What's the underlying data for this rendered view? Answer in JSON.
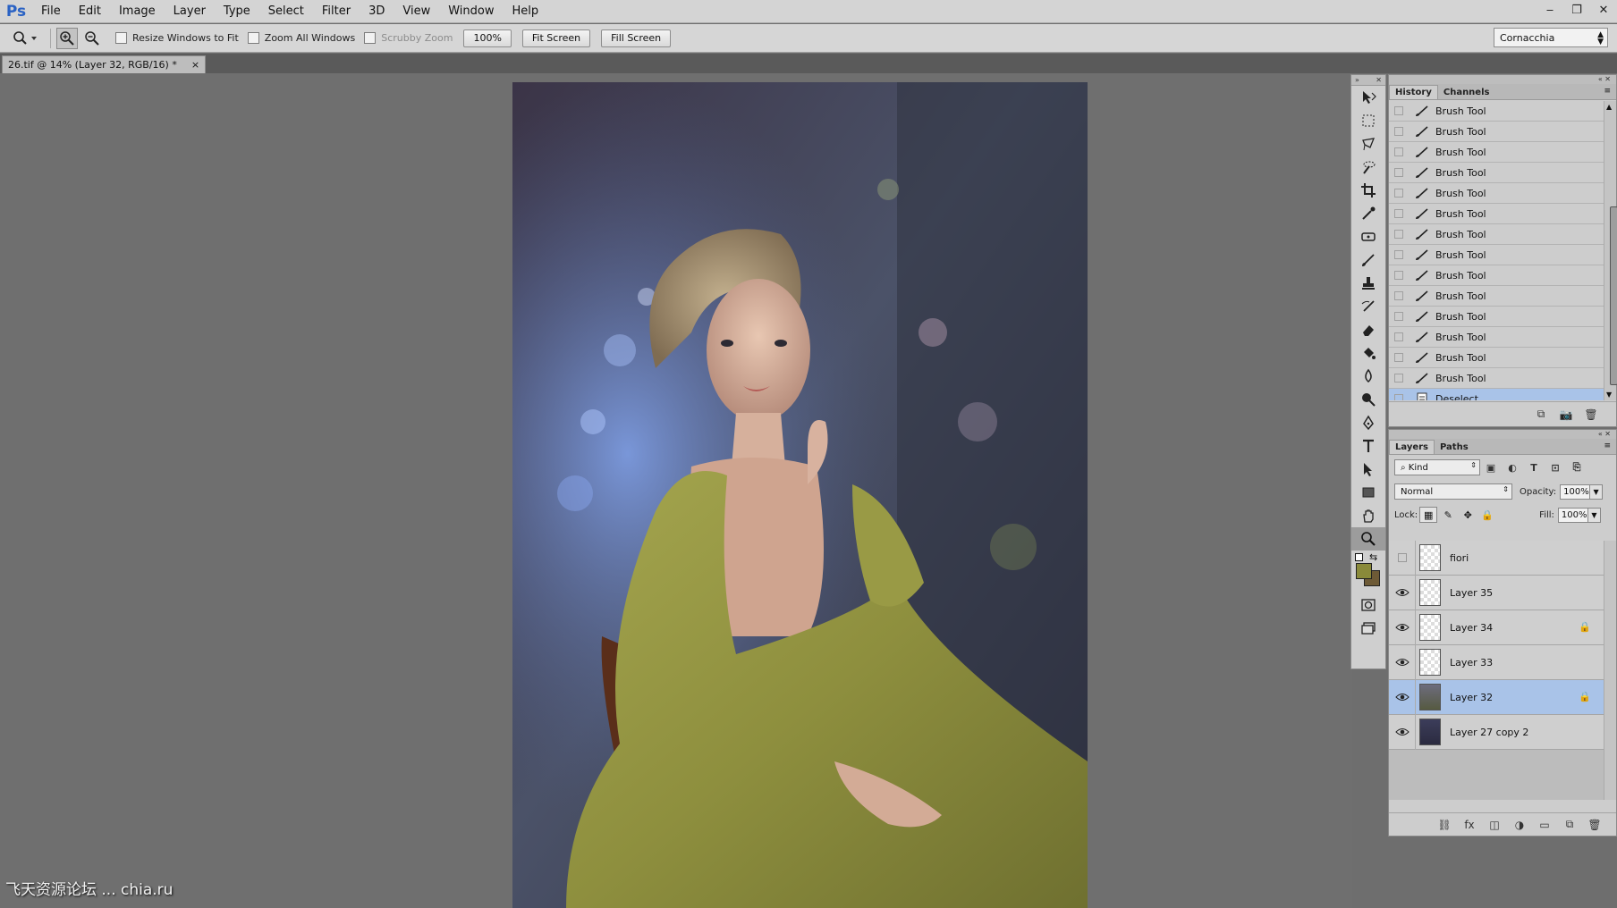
{
  "app": {
    "logo": "Ps"
  },
  "menu": [
    "File",
    "Edit",
    "Image",
    "Layer",
    "Type",
    "Select",
    "Filter",
    "3D",
    "View",
    "Window",
    "Help"
  ],
  "window_controls": {
    "minimize": "‒",
    "restore": "❐",
    "close": "✕"
  },
  "options_bar": {
    "tool_icon": "zoom-tool-icon",
    "resize_windows_label": "Resize Windows to Fit",
    "zoom_all_windows_label": "Zoom All Windows",
    "scrubby_zoom_label": "Scrubby Zoom",
    "zoom_100_label": "100%",
    "fit_screen_label": "Fit Screen",
    "fill_screen_label": "Fill Screen",
    "workspace": "Cornacchia"
  },
  "document": {
    "tab_title": "26.tif @ 14% (Layer 32, RGB/16) *",
    "close": "×"
  },
  "watermark": "飞天资源论坛 ... chia.ru",
  "colors": {
    "fg": "#8a8a3a",
    "bg": "#6d5a36",
    "accent": "#a9c3e8"
  },
  "history": {
    "tabs": [
      "History",
      "Channels"
    ],
    "items": [
      {
        "label": "Brush Tool",
        "icon": "brush-icon"
      },
      {
        "label": "Brush Tool",
        "icon": "brush-icon"
      },
      {
        "label": "Brush Tool",
        "icon": "brush-icon"
      },
      {
        "label": "Brush Tool",
        "icon": "brush-icon"
      },
      {
        "label": "Brush Tool",
        "icon": "brush-icon"
      },
      {
        "label": "Brush Tool",
        "icon": "brush-icon"
      },
      {
        "label": "Brush Tool",
        "icon": "brush-icon"
      },
      {
        "label": "Brush Tool",
        "icon": "brush-icon"
      },
      {
        "label": "Brush Tool",
        "icon": "brush-icon"
      },
      {
        "label": "Brush Tool",
        "icon": "brush-icon"
      },
      {
        "label": "Brush Tool",
        "icon": "brush-icon"
      },
      {
        "label": "Brush Tool",
        "icon": "brush-icon"
      },
      {
        "label": "Brush Tool",
        "icon": "brush-icon"
      },
      {
        "label": "Brush Tool",
        "icon": "brush-icon"
      },
      {
        "label": "Deselect",
        "icon": "document-icon",
        "selected": true
      }
    ]
  },
  "layers": {
    "tabs": [
      "Layers",
      "Paths"
    ],
    "filter_kind": "Kind",
    "blend_mode": "Normal",
    "opacity_label": "Opacity:",
    "opacity": "100%",
    "lock_label": "Lock:",
    "fill_label": "Fill:",
    "fill": "100%",
    "items": [
      {
        "name": "fiori",
        "visible": false,
        "locked": false,
        "thumb": "transparent"
      },
      {
        "name": "Layer 35",
        "visible": true,
        "locked": false,
        "thumb": "transparent"
      },
      {
        "name": "Layer 34",
        "visible": true,
        "locked": true,
        "thumb": "transparent"
      },
      {
        "name": "Layer 33",
        "visible": true,
        "locked": false,
        "thumb": "transparent"
      },
      {
        "name": "Layer 32",
        "visible": true,
        "locked": true,
        "thumb": "figure",
        "selected": true
      },
      {
        "name": "Layer 27 copy 2",
        "visible": true,
        "locked": false,
        "thumb": "photo"
      }
    ]
  }
}
